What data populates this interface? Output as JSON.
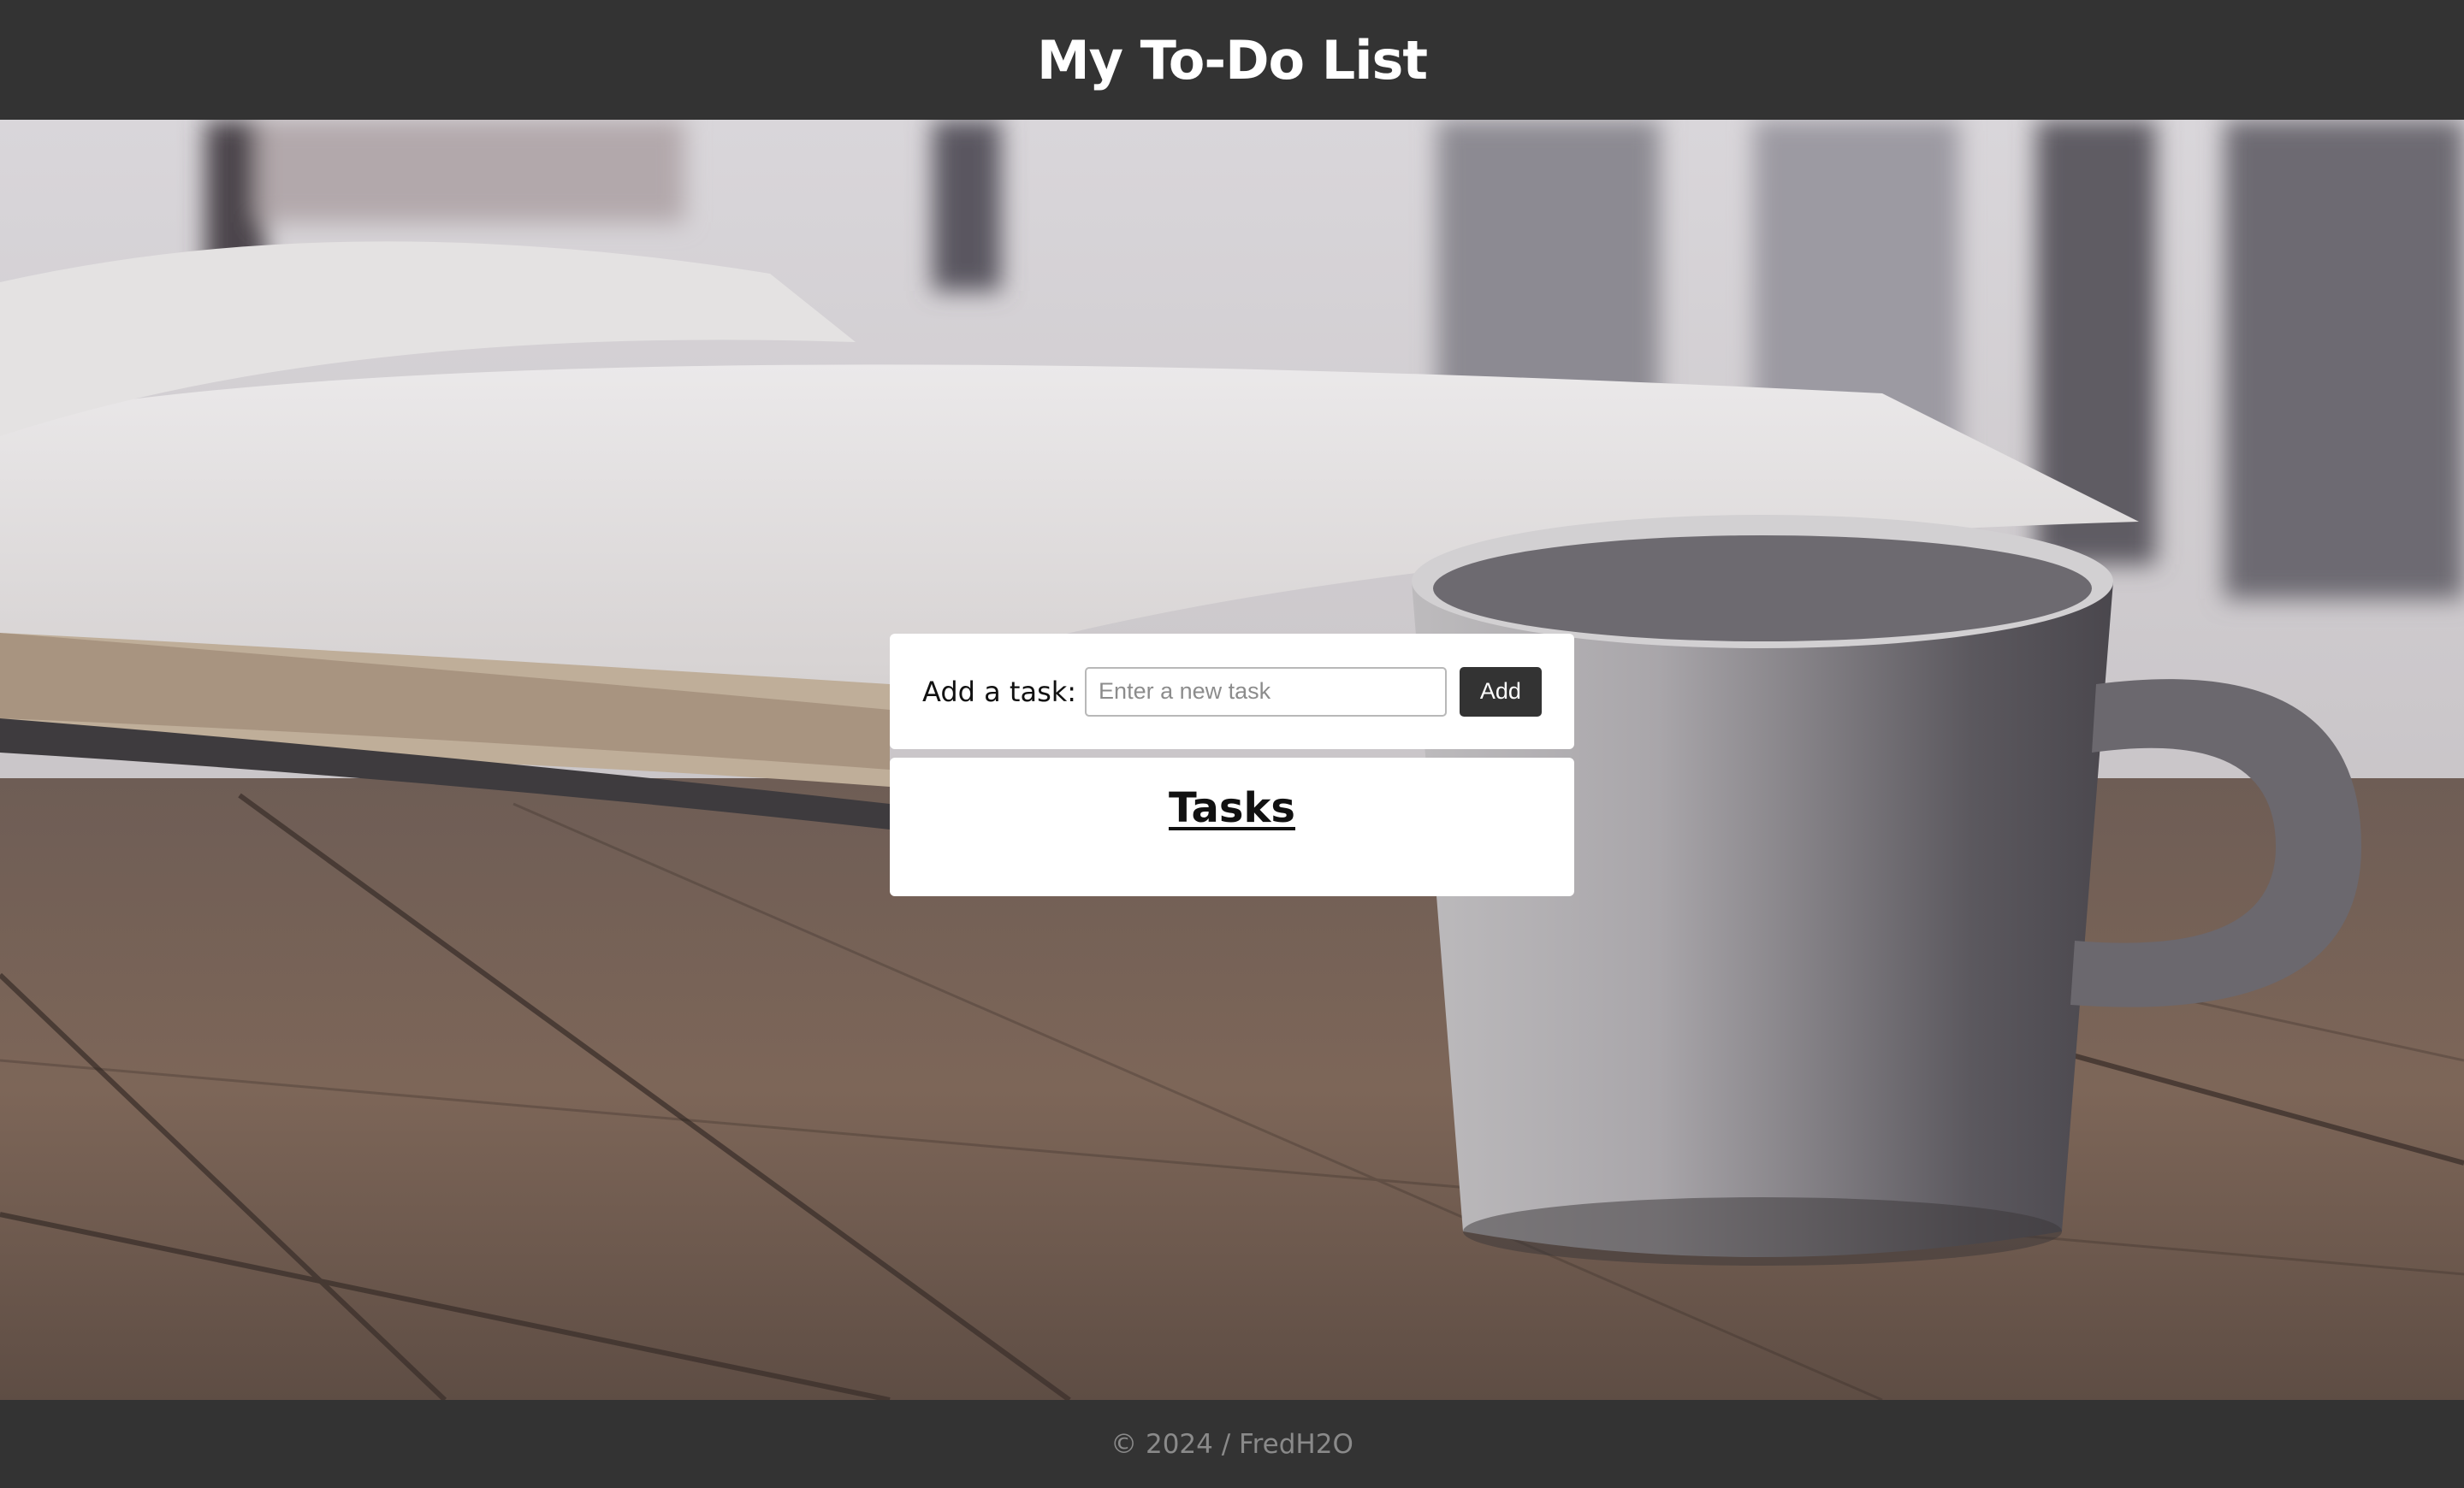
{
  "header": {
    "title": "My To-Do List"
  },
  "add_task": {
    "label": "Add a task:",
    "input_placeholder": "Enter a new task",
    "input_value": "",
    "button_label": "Add"
  },
  "tasks": {
    "heading": "Tasks",
    "items": []
  },
  "footer": {
    "text": "© 2024 / FredH2O"
  },
  "colors": {
    "header_bg": "#333333",
    "footer_bg": "#333333",
    "button_bg": "#333333",
    "card_bg": "#ffffff"
  }
}
